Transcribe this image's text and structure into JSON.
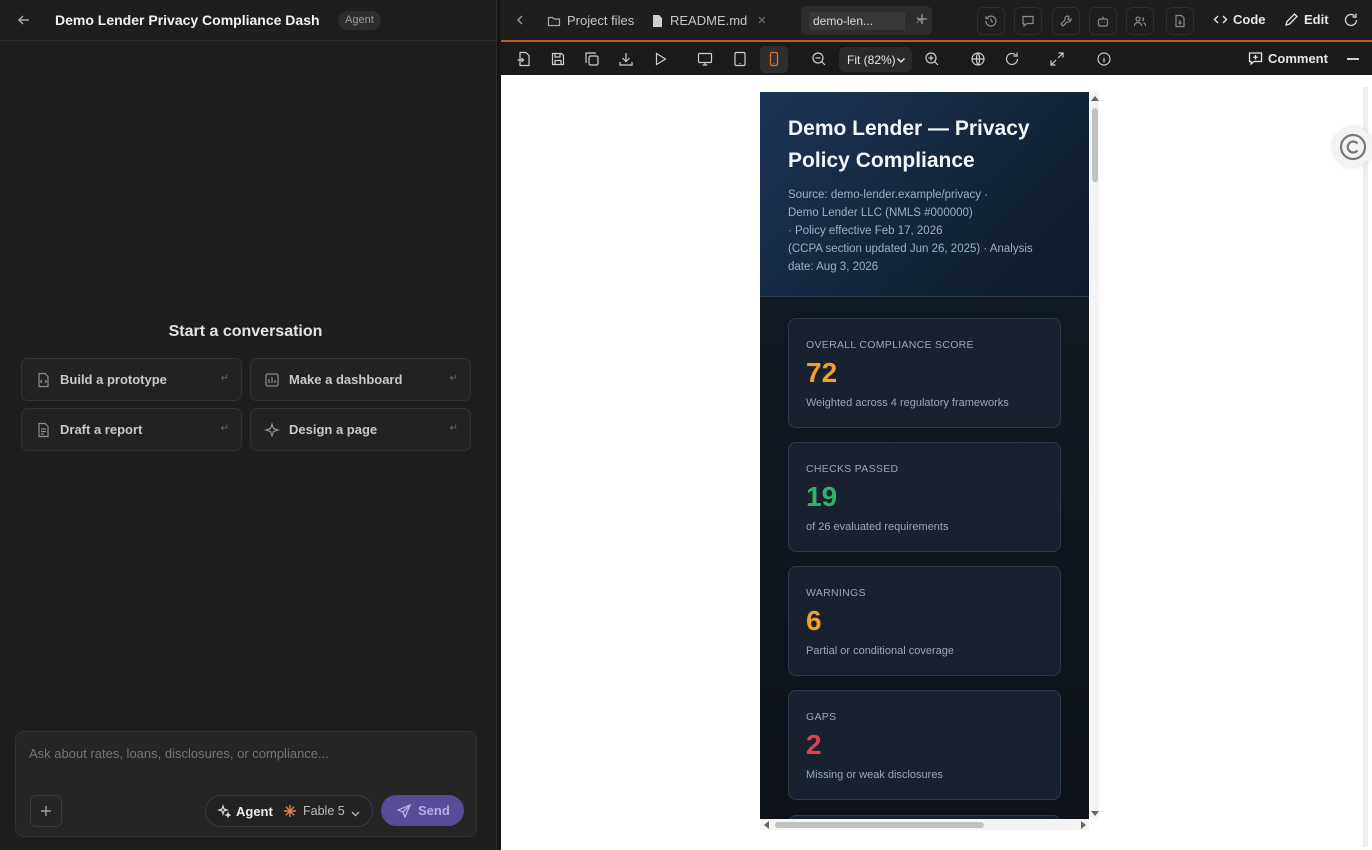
{
  "left": {
    "project_title": "Demo Lender Privacy Compliance Dash",
    "mode_badge": "Agent",
    "start_title": "Start a conversation",
    "suggestions": [
      {
        "label": "Build a prototype",
        "icon": "code-file-icon"
      },
      {
        "label": "Make a dashboard",
        "icon": "dashboard-icon"
      },
      {
        "label": "Draft a report",
        "icon": "document-icon"
      },
      {
        "label": "Design a page",
        "icon": "sparkle-icon"
      }
    ],
    "composer": {
      "placeholder": "Ask about rates, loans, disclosures, or compliance...",
      "agent_label": "Agent",
      "model_label": "Fable 5",
      "send_label": "Send"
    }
  },
  "right": {
    "tabs": {
      "project_files": "Project files",
      "readme": "README.md",
      "active_tab_value": "demo-len..."
    },
    "actions": {
      "code": "Code",
      "edit": "Edit",
      "comment": "Comment",
      "zoom": "Fit (82%)"
    },
    "preview": {
      "title": "Demo Lender — Privacy Policy Compliance",
      "meta_lines": [
        "Source: demo-lender.example/privacy ·",
        "Demo Lender LLC (NMLS #000000)",
        "· Policy effective Feb 17, 2026",
        "(CCPA section updated Jun 26, 2025) · Analysis",
        "date: Aug 3, 2026"
      ],
      "kpis": [
        {
          "label": "OVERALL COMPLIANCE SCORE",
          "value": "72",
          "sub": "Weighted across 4 regulatory frameworks",
          "color": "#f0a030"
        },
        {
          "label": "CHECKS PASSED",
          "value": "19",
          "sub": "of 26 evaluated requirements",
          "color": "#2fb36a"
        },
        {
          "label": "WARNINGS",
          "value": "6",
          "sub": "Partial or conditional coverage",
          "color": "#f0a030"
        },
        {
          "label": "GAPS",
          "value": "2",
          "sub": "Missing or weak disclosures",
          "color": "#e0404f"
        }
      ]
    }
  },
  "colors": {
    "accent_orange": "#c85a28",
    "send_purple": "#5a4a9a"
  }
}
